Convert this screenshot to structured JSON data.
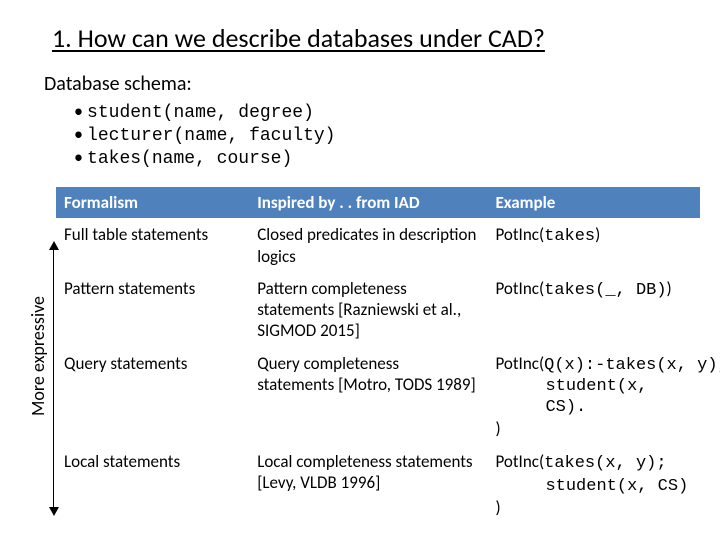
{
  "title": "1. How can we describe databases under CAD?",
  "subheading": "Database schema:",
  "schema": [
    "student(name, degree)",
    "lecturer(name, faculty)",
    "takes(name, course)"
  ],
  "axis_label": "More expressive",
  "table": {
    "headers": [
      "Formalism",
      "Inspired by . . from IAD",
      "Example"
    ],
    "rows": [
      {
        "formalism": "Full table statements",
        "inspired": "Closed predicates in description logics",
        "ex_prefix": "PotInc(",
        "ex_mono": "takes",
        "ex_suffix": ")"
      },
      {
        "formalism": "Pattern statements",
        "inspired": "Pattern completeness statements [Razniewski et al., SIGMOD 2015]",
        "ex_prefix": "PotInc(",
        "ex_mono": "takes(_, DB)",
        "ex_suffix": ")"
      },
      {
        "formalism": "Query statements",
        "inspired": "Query completeness statements [Motro, TODS 1989]",
        "ex_prefix": "PotInc(",
        "ex_mono": "Q(x):-takes(x, y),",
        "ex_mono2": "student(x, CS).",
        "ex_suffix": ")"
      },
      {
        "formalism": "Local statements",
        "inspired": "Local completeness statements [Levy, VLDB 1996]",
        "ex_prefix": "PotInc(",
        "ex_mono": "takes(x, y);",
        "ex_mono2": "student(x, CS)",
        "ex_suffix": ")"
      }
    ]
  }
}
